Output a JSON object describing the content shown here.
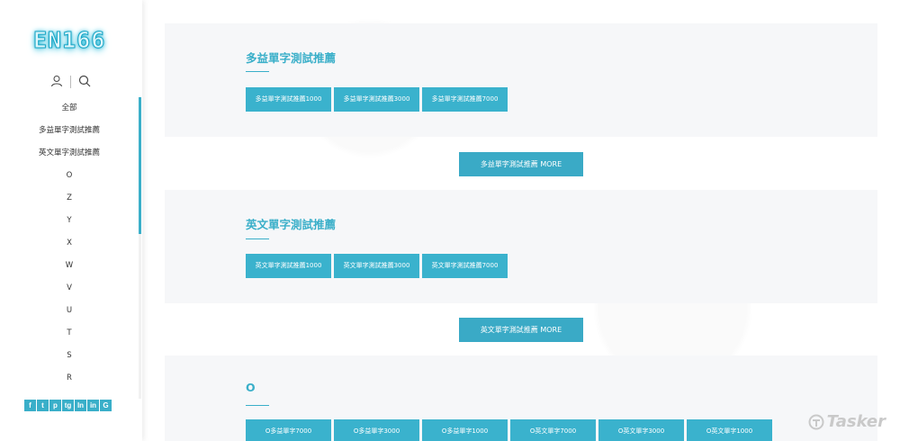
{
  "brand": {
    "logo_text": "EN166"
  },
  "sidebar": {
    "items": [
      {
        "label": "全部"
      },
      {
        "label": "多益單字測試推薦"
      },
      {
        "label": "英文單字測試推薦"
      },
      {
        "label": "O"
      },
      {
        "label": "Z"
      },
      {
        "label": "Y"
      },
      {
        "label": "X"
      },
      {
        "label": "W"
      },
      {
        "label": "V"
      },
      {
        "label": "U"
      },
      {
        "label": "T"
      },
      {
        "label": "S"
      },
      {
        "label": "R"
      }
    ],
    "social": [
      "f",
      "t",
      "p",
      "tg",
      "ln",
      "in",
      "G"
    ],
    "social_icons": [
      "facebook-icon",
      "twitter-icon",
      "pinterest-icon",
      "telegram-icon",
      "line-icon",
      "linkedin-icon",
      "google-icon"
    ]
  },
  "sections": [
    {
      "title": "多益單字測試推薦",
      "buttons": [
        "多益單字測試推薦1000",
        "多益單字測試推薦3000",
        "多益單字測試推薦7000"
      ],
      "more": "多益單字測試推薦 MORE"
    },
    {
      "title": "英文單字測試推薦",
      "buttons": [
        "英文單字測試推薦1000",
        "英文單字測試推薦3000",
        "英文單字測試推薦7000"
      ],
      "more": "英文單字測試推薦 MORE"
    },
    {
      "title": "O",
      "buttons": [
        "O多益單字7000",
        "O多益單字3000",
        "O多益單字1000",
        "O英文單字7000",
        "O英文單字3000",
        "O英文單字1000"
      ]
    }
  ],
  "watermark": {
    "text": "Tasker"
  },
  "colors": {
    "accent": "#3ab2cd",
    "panel": "#f6f7f9"
  }
}
